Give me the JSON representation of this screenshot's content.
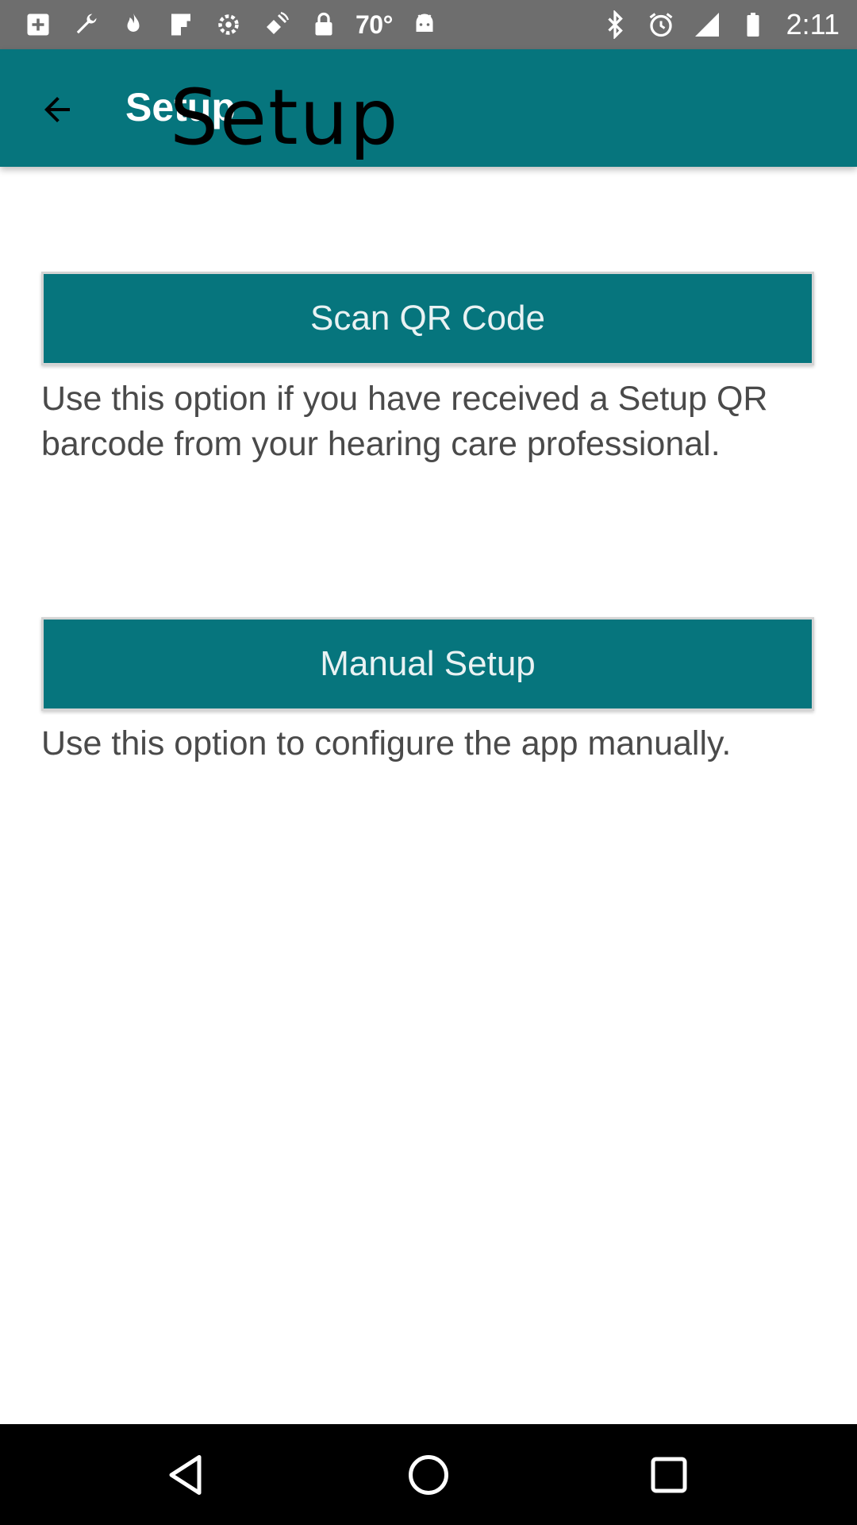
{
  "status_bar": {
    "temperature": "70°",
    "time": "2:11",
    "left_icons": [
      "add-box-icon",
      "wrench-icon",
      "flame-icon",
      "flipboard-icon",
      "settings-icon",
      "fake-gps-satellite-icon",
      "lock-icon",
      "android-icon"
    ],
    "right_icons": [
      "bluetooth-icon",
      "alarm-icon",
      "signal-icon",
      "battery-icon"
    ]
  },
  "app_bar": {
    "title": "Setup",
    "overlay_title": "Setup",
    "background": "#06757d"
  },
  "options": {
    "scan": {
      "label": "Scan QR Code",
      "description": "Use this option if you have received a Setup QR barcode from your hearing care professional."
    },
    "manual": {
      "label": "Manual Setup",
      "description": "Use this option to configure the app manually."
    }
  },
  "nav_bar": {
    "icons": [
      "back-triangle-icon",
      "home-circle-icon",
      "recents-square-icon"
    ]
  },
  "colors": {
    "accent": "#06757d",
    "status_bar": "#6e6e6e",
    "text": "#4a4a4a"
  }
}
